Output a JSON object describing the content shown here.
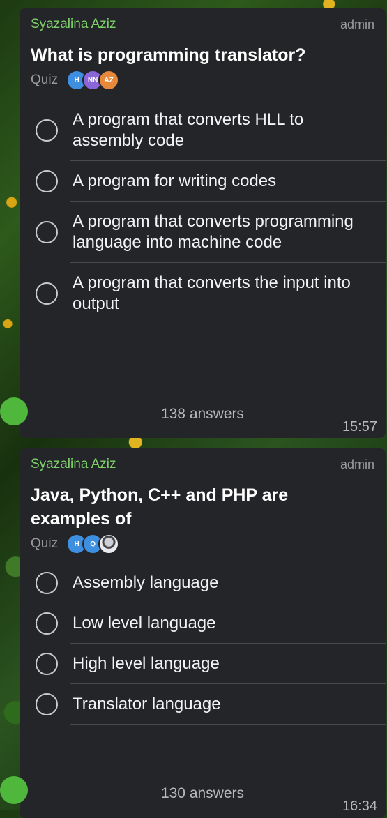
{
  "polls": [
    {
      "sender": "Syazalina Aziz",
      "role": "admin",
      "question": "What is programming translator?",
      "type_label": "Quiz",
      "voter_avatars": [
        {
          "initials": "H",
          "color": "#3f8fe0"
        },
        {
          "initials": "NN",
          "color": "#8a66d8"
        },
        {
          "initials": "AZ",
          "color": "#e8883a"
        }
      ],
      "options": [
        "A program that converts HLL to assembly code",
        "A program for writing codes",
        "A program that converts programming language into machine code",
        "A program that converts the input into output"
      ],
      "answers": "138 answers",
      "time": "15:57"
    },
    {
      "sender": "Syazalina Aziz",
      "role": "admin",
      "question": "Java, Python, C++ and PHP are examples of",
      "type_label": "Quiz",
      "voter_avatars": [
        {
          "initials": "H",
          "color": "#3f8fe0"
        },
        {
          "initials": "Q",
          "color": "#3f8fe0"
        },
        {
          "initials": "",
          "color": "#e9e9ee"
        }
      ],
      "options": [
        "Assembly language",
        "Low level language",
        "High level language",
        "Translator language"
      ],
      "answers": "130 answers",
      "time": "16:34"
    }
  ]
}
